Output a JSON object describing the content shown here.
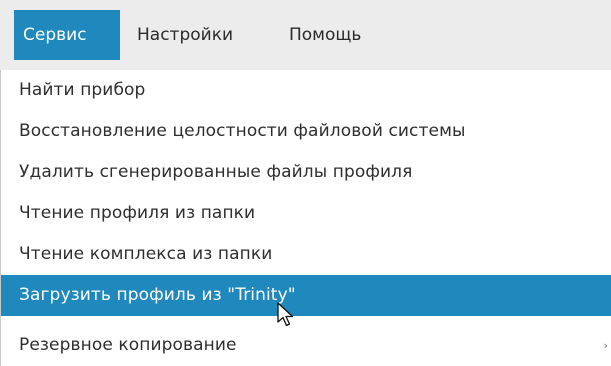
{
  "menubar": {
    "items": [
      {
        "label": "Сервис"
      },
      {
        "label": "Настройки"
      },
      {
        "label": "Помощь"
      }
    ]
  },
  "dropdown": {
    "items": [
      {
        "label": "Найти прибор"
      },
      {
        "label": "Восстановление целостности файловой системы"
      },
      {
        "label": "Удалить сгенерированные файлы профиля"
      },
      {
        "label": "Чтение профиля из папки"
      },
      {
        "label": "Чтение комплекса из папки"
      },
      {
        "label": "Загрузить профиль из \"Trinity\""
      },
      {
        "label": "Резервное копирование",
        "submenu_arrow": "›"
      }
    ]
  },
  "colors": {
    "accent": "#1f89bd",
    "menubar_bg": "#ececec",
    "text": "#2e2e2e"
  }
}
